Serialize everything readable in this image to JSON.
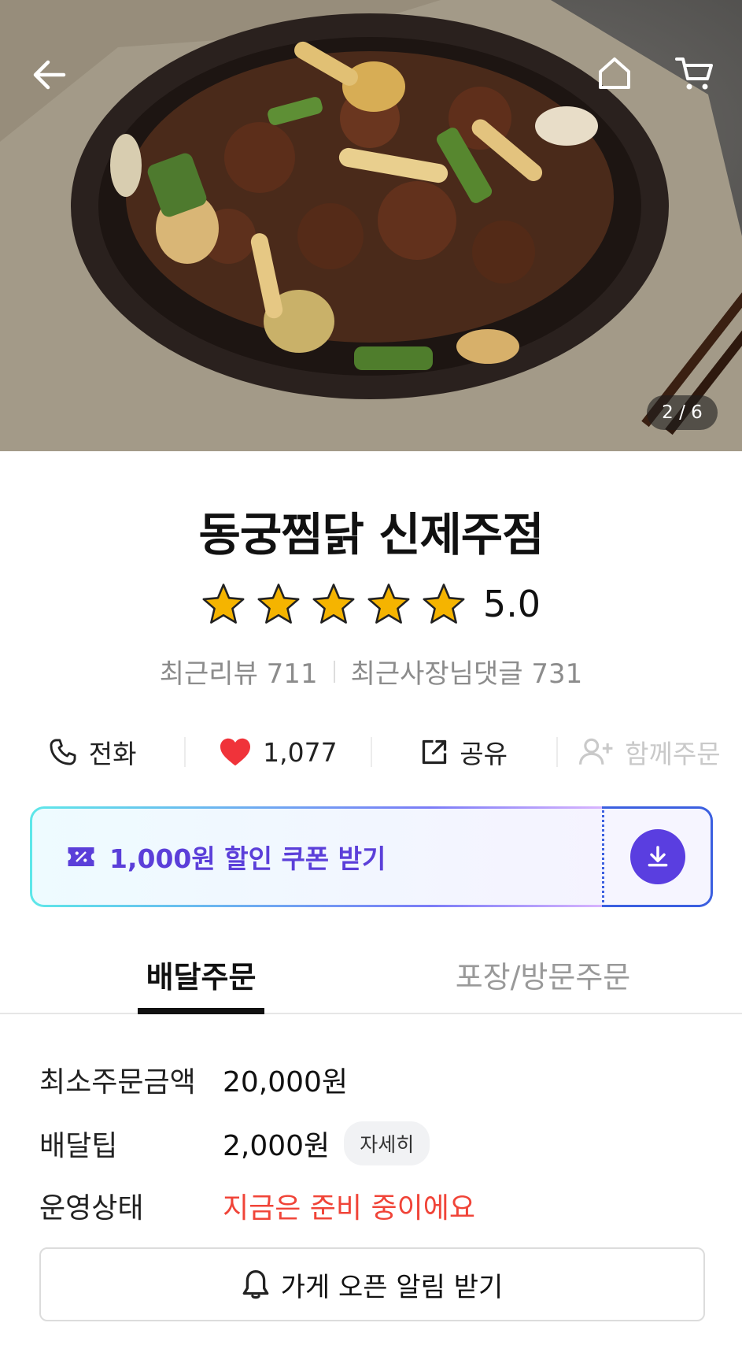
{
  "hero": {
    "image_counter": "2 / 6"
  },
  "store": {
    "name": "동궁찜닭 신제주점",
    "rating": "5.0",
    "stars": 5
  },
  "reviews": {
    "recent_reviews": "최근리뷰 711",
    "owner_comments": "최근사장님댓글 731"
  },
  "actions": {
    "call": "전화",
    "likes": "1,077",
    "share": "공유",
    "group_order": "함께주문"
  },
  "coupon": {
    "label": "1,000원 할인 쿠폰 받기"
  },
  "tabs": {
    "delivery": "배달주문",
    "pickup": "포장/방문주문"
  },
  "info": {
    "min_order_label": "최소주문금액",
    "min_order_value": "20,000원",
    "tip_label": "배달팁",
    "tip_value": "2,000원",
    "tip_detail": "자세히",
    "status_label": "운영상태",
    "status_value": "지금은 준비 중이에요"
  },
  "notify": {
    "label": "가게 오픈 알림 받기"
  },
  "colors": {
    "accent": "#5a3ee0",
    "status_red": "#f04438",
    "star": "#f5b400"
  }
}
